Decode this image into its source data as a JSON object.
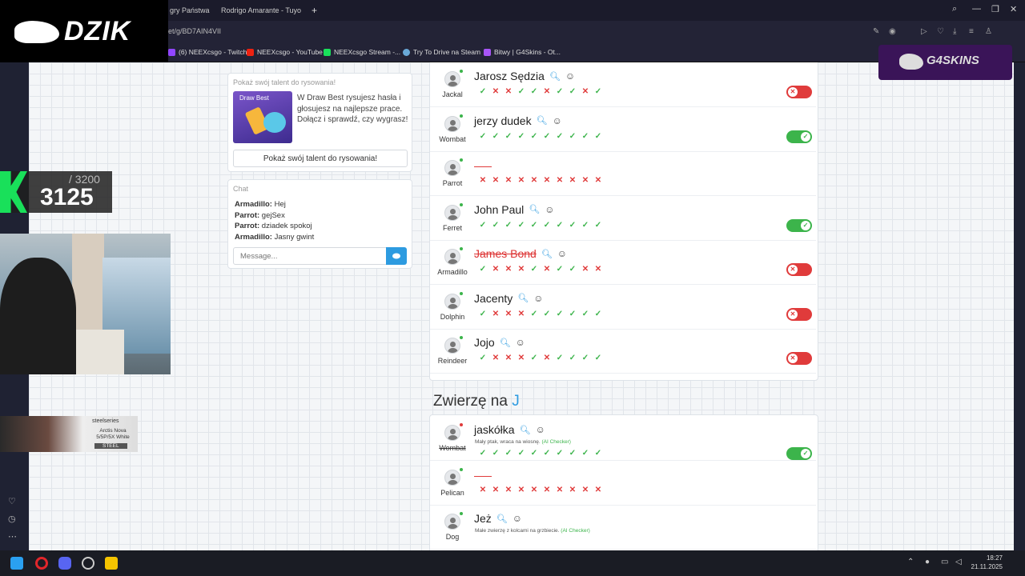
{
  "browser": {
    "tabs": [
      {
        "label": "gry Państwa M"
      },
      {
        "label": "Rodrigo Amarante - Tuyo"
      }
    ],
    "new_tab": "+",
    "url": "et/g/BD7AIN4VII",
    "bookmarks": [
      {
        "label": "(6) NEEXcsgo - Twitch",
        "color": "#9146ff"
      },
      {
        "label": "NEEXcsgo - YouTube",
        "color": "#e21"
      },
      {
        "label": "NEEXcsgo Stream -...",
        "color": "#19e05a"
      },
      {
        "label": "Try To Drive na Steam",
        "color": "#6aa9d8"
      },
      {
        "label": "Bitwy | G4Skins - Ot...",
        "color": "#a855f7"
      }
    ]
  },
  "promo": {
    "title": "Pokaż swój talent do rysowania!",
    "image_title": "Draw Best",
    "text": "W Draw Best rysujesz hasła i głosujesz na najlepsze prace. Dołącz i sprawdź, czy wygrasz!",
    "button": "Pokaż swój talent do rysowania!"
  },
  "chat": {
    "title": "Chat",
    "messages": [
      {
        "user": "Armadillo:",
        "text": " Hej"
      },
      {
        "user": "Parrot:",
        "text": " gejSex"
      },
      {
        "user": "Parrot:",
        "text": " dziadek spokoj"
      },
      {
        "user": "Armadillo:",
        "text": " Jasny gwint"
      }
    ],
    "placeholder": "Message..."
  },
  "answers_top": [
    {
      "user": "Jackal",
      "answer": "Jarosz Sędzia",
      "votes": [
        1,
        0,
        0,
        1,
        1,
        0,
        1,
        1,
        0,
        1
      ],
      "toggle": "off"
    },
    {
      "user": "Wombat",
      "answer": "jerzy dudek",
      "votes": [
        1,
        1,
        1,
        1,
        1,
        1,
        1,
        1,
        1,
        1
      ],
      "toggle": "on"
    },
    {
      "user": "Parrot",
      "answer": "",
      "votes": [
        0,
        0,
        0,
        0,
        0,
        0,
        0,
        0,
        0,
        0
      ],
      "toggle": "none"
    },
    {
      "user": "Ferret",
      "answer": "John Paul",
      "votes": [
        1,
        1,
        1,
        1,
        1,
        1,
        1,
        1,
        1,
        1
      ],
      "toggle": "on"
    },
    {
      "user": "Armadillo",
      "answer": "James Bond",
      "votes": [
        1,
        0,
        0,
        0,
        1,
        0,
        1,
        1,
        0,
        0
      ],
      "toggle": "off",
      "struck": true
    },
    {
      "user": "Dolphin",
      "answer": "Jacenty",
      "votes": [
        1,
        0,
        0,
        0,
        1,
        1,
        1,
        1,
        1,
        1
      ],
      "toggle": "off"
    },
    {
      "user": "Reindeer",
      "answer": "Jojo",
      "votes": [
        1,
        0,
        0,
        0,
        1,
        0,
        1,
        1,
        1,
        1
      ],
      "toggle": "off"
    }
  ],
  "section": {
    "prefix": "Zwierzę na ",
    "letter": "J"
  },
  "answers_animal": [
    {
      "user": "Wombat",
      "answer": "jaskółka",
      "ai_text": "Mały ptak, wraca na wiosnę.",
      "ai_tag": "(AI Checker)",
      "votes": [
        1,
        1,
        1,
        1,
        1,
        1,
        1,
        1,
        1,
        1
      ],
      "toggle": "on",
      "user_struck": true
    },
    {
      "user": "Pelican",
      "answer": "",
      "votes": [
        0,
        0,
        0,
        0,
        0,
        0,
        0,
        0,
        0,
        0
      ],
      "toggle": "none"
    },
    {
      "user": "Dog",
      "answer": "Jeż",
      "ai_text": "Małe zwierzę z kolcami na grzbiecie.",
      "ai_tag": "(AI Checker)",
      "votes": [],
      "toggle": "none"
    }
  ],
  "overlay": {
    "brand": "DZIK",
    "score_max": "/ 3200",
    "score_current": "3125",
    "sponsor": "G4SKINS",
    "ss_brand": "steelseries",
    "ss_product": "Arctis Nova 5/5P/5X White",
    "ss_code": "STEEL"
  },
  "taskbar": {
    "time": "18:27",
    "date": "21.11.2025"
  },
  "colors": {
    "accent": "#2d9be0",
    "ok": "#3cb44b",
    "bad": "#e03b3b"
  }
}
